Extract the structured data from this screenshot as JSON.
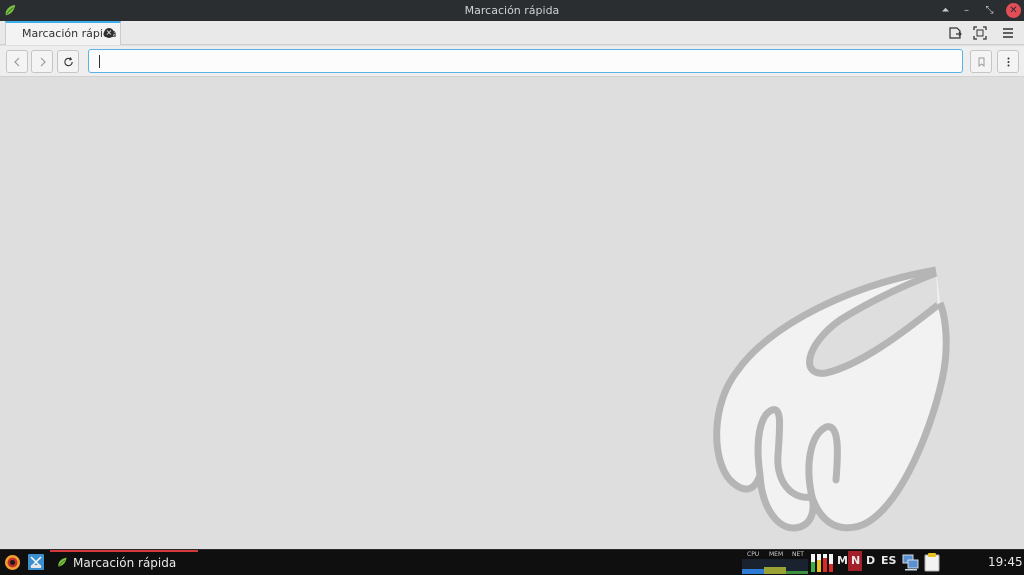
{
  "window": {
    "title": "Marcación rápida",
    "buttons": {
      "shade": "⏶",
      "minimize": "–",
      "restore": "⤡",
      "close": "✕"
    }
  },
  "tabs": [
    {
      "label": "Marcación rápida",
      "active": true
    }
  ],
  "tabbar_icons": [
    "closed-tabs-icon",
    "fullscreen-icon",
    "menu-icon"
  ],
  "navigation": {
    "back": "back-icon",
    "forward": "forward-icon",
    "reload": "reload-icon",
    "address_value": "",
    "right_buttons": [
      "bookmark-icon",
      "more-menu-icon"
    ]
  },
  "taskbar": {
    "task_label": "Marcación rápida",
    "monitor_labels": {
      "cpu": "CPU",
      "mem": "MEM",
      "net": "NET"
    },
    "locks": {
      "m": "M",
      "n": "N",
      "d": "D"
    },
    "keyboard_layout": "ES",
    "clock": "19:45"
  },
  "colors": {
    "accent": "#3daee9",
    "titlebar": "#2b2e31",
    "close": "#e14e55",
    "task_active": "#d5383c"
  }
}
